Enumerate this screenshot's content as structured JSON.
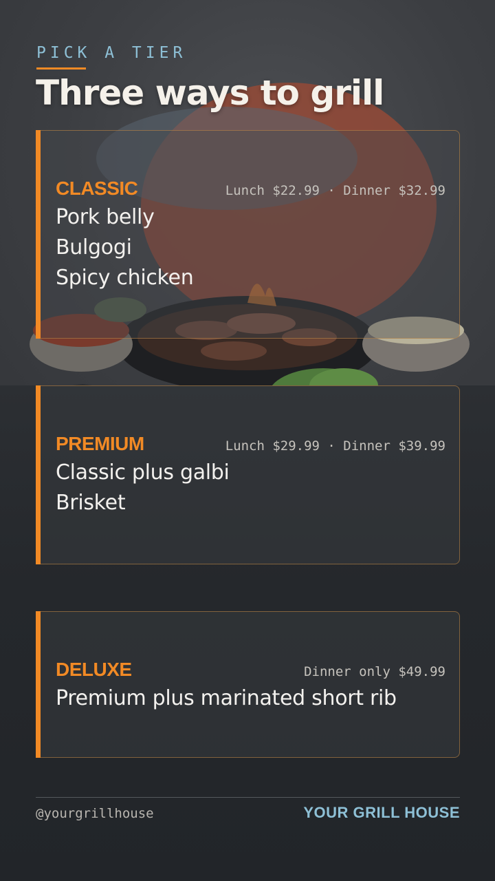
{
  "header": {
    "eyebrow": "PICK A TIER",
    "title": "Three ways to grill"
  },
  "tiers": [
    {
      "name": "CLASSIC",
      "price": "Lunch $22.99 · Dinner $32.99",
      "items": [
        "Pork belly",
        "Bulgogi",
        "Spicy chicken"
      ]
    },
    {
      "name": "PREMIUM",
      "price": "Lunch $29.99 · Dinner $39.99",
      "items": [
        "Classic plus galbi",
        "Brisket"
      ]
    },
    {
      "name": "DELUXE",
      "price": "Dinner only $49.99",
      "items": [
        "Premium plus marinated short rib"
      ]
    }
  ],
  "footer": {
    "handle": "@yourgrillhouse",
    "brand": "YOUR GRILL HOUSE"
  },
  "colors": {
    "accent": "#f28a25",
    "secondary": "#8ec0d6",
    "background": "#26292d"
  }
}
